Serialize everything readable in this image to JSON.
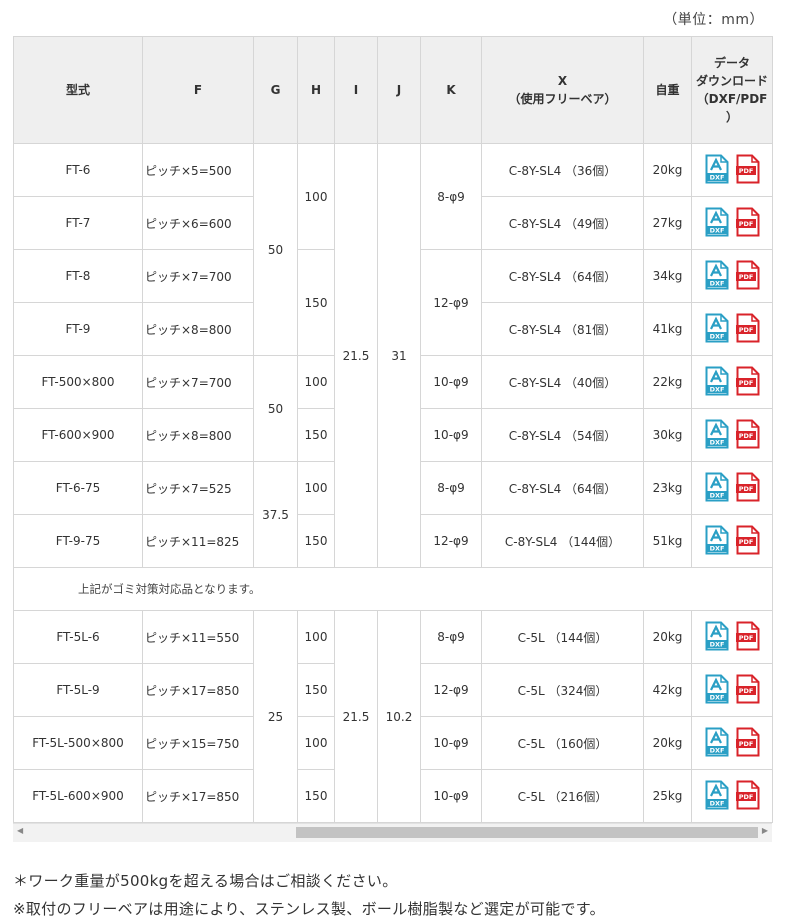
{
  "unit": "（単位：mm）",
  "headers": {
    "model": "型式",
    "f": "F",
    "g": "G",
    "h": "H",
    "i": "I",
    "j": "J",
    "k": "K",
    "x_line1": "X",
    "x_line2": "（使用フリーベア）",
    "weight": "自重",
    "dl_line1": "データ",
    "dl_line2": "ダウンロード",
    "dl_line3": "（DXF/PDF",
    "dl_line4": "）"
  },
  "rows": [
    {
      "model": "FT-6",
      "f": "ピッチ×5=500",
      "x": "C-8Y-SL4 （36個）",
      "weight": "20kg"
    },
    {
      "model": "FT-7",
      "f": "ピッチ×6=600",
      "x": "C-8Y-SL4 （49個）",
      "weight": "27kg"
    },
    {
      "model": "FT-8",
      "f": "ピッチ×7=700",
      "x": "C-8Y-SL4 （64個）",
      "weight": "34kg"
    },
    {
      "model": "FT-9",
      "f": "ピッチ×8=800",
      "x": "C-8Y-SL4 （81個）",
      "weight": "41kg"
    },
    {
      "model": "FT-500×800",
      "f": "ピッチ×7=700",
      "x": "C-8Y-SL4 （40個）",
      "weight": "22kg"
    },
    {
      "model": "FT-600×900",
      "f": "ピッチ×8=800",
      "x": "C-8Y-SL4 （54個）",
      "weight": "30kg"
    },
    {
      "model": "FT-6-75",
      "f": "ピッチ×7=525",
      "x": "C-8Y-SL4 （64個）",
      "weight": "23kg"
    },
    {
      "model": "FT-9-75",
      "f": "ピッチ×11=825",
      "x": "C-8Y-SL4 （144個）",
      "weight": "51kg"
    },
    {
      "model": "FT-5L-6",
      "f": "ピッチ×11=550",
      "x": "C-5L （144個）",
      "weight": "20kg"
    },
    {
      "model": "FT-5L-9",
      "f": "ピッチ×17=850",
      "x": "C-5L （324個）",
      "weight": "42kg"
    },
    {
      "model": "FT-5L-500×800",
      "f": "ピッチ×15=750",
      "x": "C-5L （160個）",
      "weight": "20kg"
    },
    {
      "model": "FT-5L-600×900",
      "f": "ピッチ×17=850",
      "x": "C-5L （216個）",
      "weight": "25kg"
    }
  ],
  "merged": {
    "g_a": "50",
    "g_b": "50",
    "g_c": "37.5",
    "g_d": "25",
    "h_100": "100",
    "h_150": "150",
    "i_a": "21.5",
    "i_b": "21.5",
    "j_a": "31",
    "j_b": "10.2",
    "k_8": "8-φ9",
    "k_12": "12-φ9",
    "k_10": "10-φ9"
  },
  "section_note": "上記がゴミ対策対応品となります。",
  "icons": {
    "dxf": "dxf-file-icon",
    "pdf": "pdf-file-icon",
    "dxf_label": "DXF",
    "pdf_label": "PDF",
    "dxf_color": "#2a9fc5",
    "pdf_color": "#d9232a"
  },
  "footnotes": [
    "＊ワーク重量が500kgを超える場合はご相談ください。",
    "※取付のフリーベアは用途により、ステンレス製、ボール樹脂製など選定が可能です。"
  ]
}
